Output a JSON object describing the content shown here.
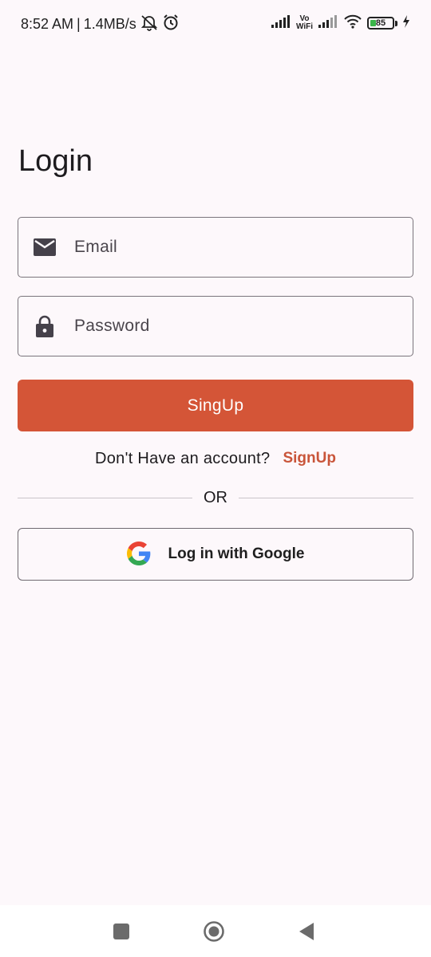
{
  "status_bar": {
    "time": "8:52 AM",
    "network_speed": "1.4MB/s",
    "vowifi_top": "Vo",
    "vowifi_bottom": "WiFi",
    "battery_level": "85",
    "icons": [
      "mute-icon",
      "alarm-icon",
      "signal-icon",
      "vowifi-icon",
      "signal-icon",
      "wifi-icon",
      "battery-icon",
      "charging-icon"
    ]
  },
  "login": {
    "title": "Login",
    "email_placeholder": "Email",
    "email_icon": "mail-icon",
    "password_placeholder": "Password",
    "password_icon": "lock-icon",
    "primary_button_label": "SingUp",
    "signup_prompt": "Don't Have an account?",
    "signup_link": "SignUp",
    "divider_text": "OR",
    "google_button_label": "Log in with Google",
    "google_icon": "google-icon"
  },
  "colors": {
    "background": "#fdf8fb",
    "accent": "#d45537",
    "link": "#c9553a"
  },
  "nav_bar": {
    "icons": [
      "recents-icon",
      "home-icon",
      "back-icon"
    ]
  }
}
